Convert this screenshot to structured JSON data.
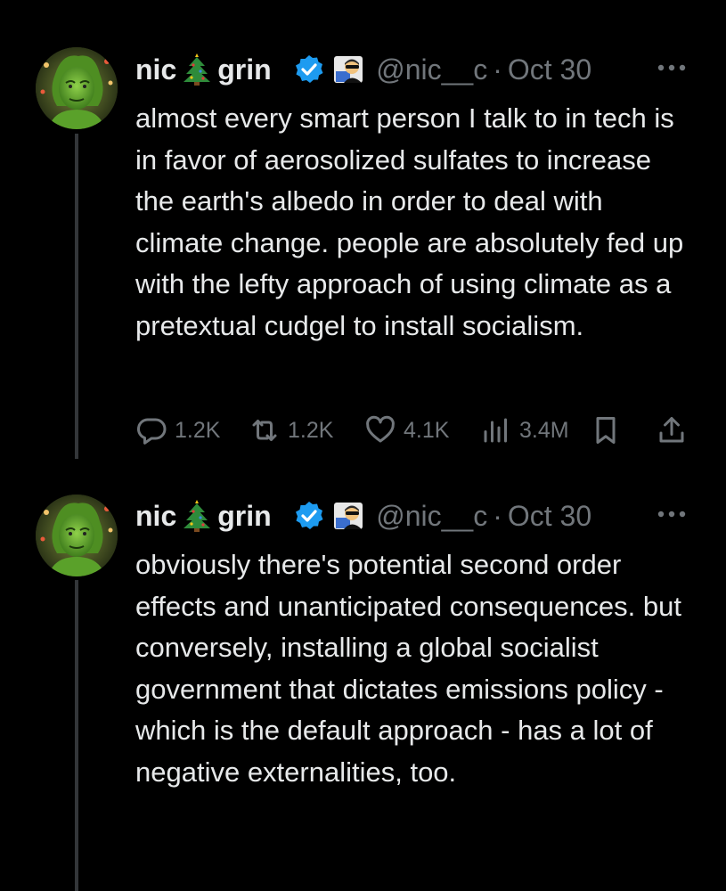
{
  "tweets": [
    {
      "name": "nic",
      "name_suffix": "grin",
      "handle": "@nic__c",
      "dot": "·",
      "date": "Oct 30",
      "text": "almost every smart person I talk to in tech is in favor of aerosolized sulfates to increase the earth's albedo in order to deal with climate change. people are absolutely fed up with the lefty approach of using climate as a pretextual cudgel to install socialism.",
      "stats": {
        "replies": "1.2K",
        "reposts": "1.2K",
        "likes": "4.1K",
        "views": "3.4M"
      },
      "icons": [
        "reply-icon",
        "repost-icon",
        "like-icon",
        "views-icon",
        "bookmark-icon",
        "share-icon"
      ]
    },
    {
      "name": "nic",
      "name_suffix": "grin",
      "handle": "@nic__c",
      "dot": "·",
      "date": "Oct 30",
      "text": "obviously there's potential second order effects and unanticipated consequences. but conversely, installing a global socialist government that dictates emissions policy - which is the default approach - has a lot of negative externalities, too."
    }
  ],
  "colors": {
    "background": "#000000",
    "text": "#e7e9ea",
    "muted": "#71767b",
    "verified": "#1d9bf0",
    "thread_line": "#333639"
  }
}
